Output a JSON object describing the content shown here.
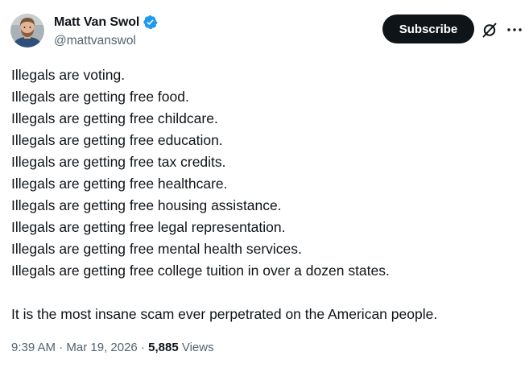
{
  "author": {
    "display_name": "Matt Van Swol",
    "handle": "@mattvanswol",
    "verified": true,
    "avatar": "avatar-photo"
  },
  "actions": {
    "subscribe_label": "Subscribe",
    "grok_icon": "grok-icon",
    "more_icon": "more-options-icon"
  },
  "post": {
    "lines": [
      "Illegals are voting.",
      "Illegals are getting free food.",
      "Illegals are getting free childcare.",
      "Illegals are getting free education.",
      "Illegals are getting free tax credits.",
      "Illegals are getting free healthcare.",
      "Illegals are getting free housing assistance.",
      "Illegals are getting free legal representation.",
      "Illegals are getting free mental health services.",
      "Illegals are getting free college tuition in over a dozen states."
    ],
    "closing": "It is the most insane scam ever perpetrated on the American people."
  },
  "meta": {
    "time": "9:39 AM",
    "separator": " · ",
    "date": "Mar 19, 2026",
    "views_count": "5,885",
    "views_label": "Views"
  },
  "colors": {
    "text": "#0f1419",
    "secondary": "#536471",
    "verified_blue": "#1d9bf0",
    "button_bg": "#0f1419"
  }
}
